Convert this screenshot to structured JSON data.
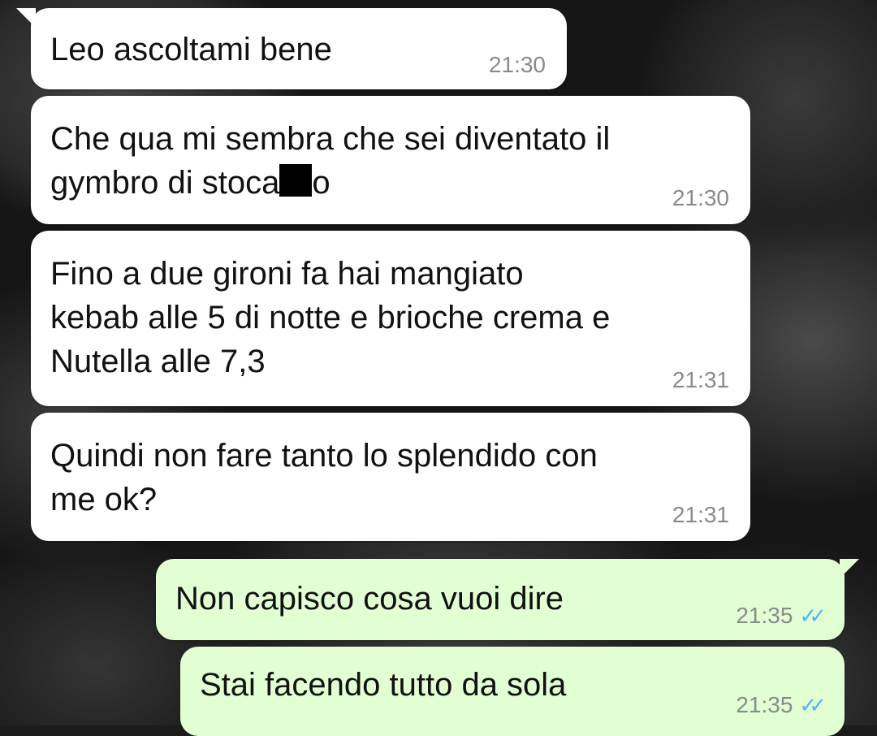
{
  "messages": [
    {
      "direction": "in",
      "text": "Leo ascoltami bene",
      "time": "21:30"
    },
    {
      "direction": "in",
      "text_before": "Che qua mi sembra che sei diventato il\ngymbro di stoca",
      "redacted": true,
      "text_after": "o",
      "time": "21:30"
    },
    {
      "direction": "in",
      "text": "Fino a due gironi fa hai mangiato\nkebab alle 5 di notte e brioche crema e\nNutella alle 7,3",
      "time": "21:31"
    },
    {
      "direction": "in",
      "text": "Quindi non fare tanto lo splendido con\nme ok?",
      "time": "21:31"
    },
    {
      "direction": "out",
      "text": "Non capisco cosa vuoi dire",
      "time": "21:35",
      "status_icon": "double-check-read"
    },
    {
      "direction": "out",
      "text": "Stai facendo tutto da sola",
      "time": "21:35",
      "status_icon": "double-check-read"
    }
  ],
  "ticks_glyph": "✓✓",
  "colors": {
    "incoming_bubble": "#ffffff",
    "outgoing_bubble": "#e2ffd4",
    "timestamp": "#8a8a8a",
    "read_ticks": "#4fb6ec"
  }
}
